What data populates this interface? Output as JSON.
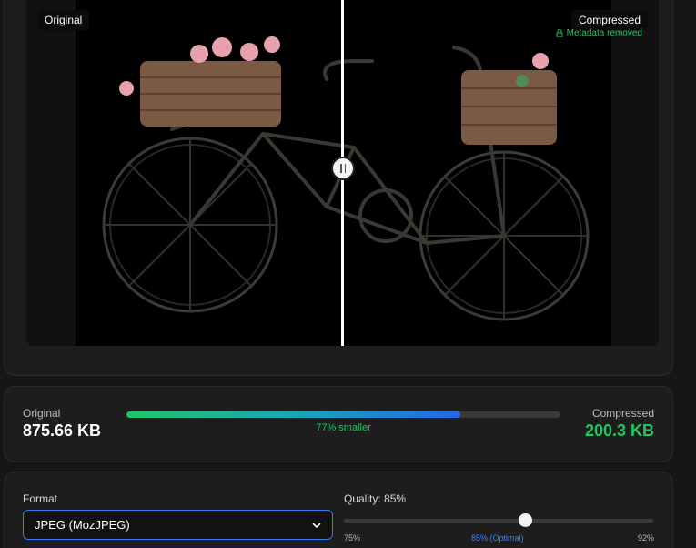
{
  "preview": {
    "original_tag": "Original",
    "compressed_tag": "Compressed",
    "metadata_note": "Metadata removed",
    "metadata_icon": "lock-icon"
  },
  "stats": {
    "original_label": "Original",
    "original_size": "875.66 KB",
    "compressed_label": "Compressed",
    "compressed_size": "200.3 KB",
    "reduction_text": "77% smaller",
    "bar_fill_fraction": 0.77,
    "colors": {
      "accent_green": "#22c55e",
      "accent_blue": "#2268e6"
    }
  },
  "settings": {
    "format_label": "Format",
    "format_value": "JPEG (MozJPEG)",
    "quality_label": "Quality: 85%",
    "quality_value": 85,
    "quality_min_label": "75%",
    "quality_optimal_label": "85% (Optimal)",
    "quality_max_label": "92%"
  }
}
